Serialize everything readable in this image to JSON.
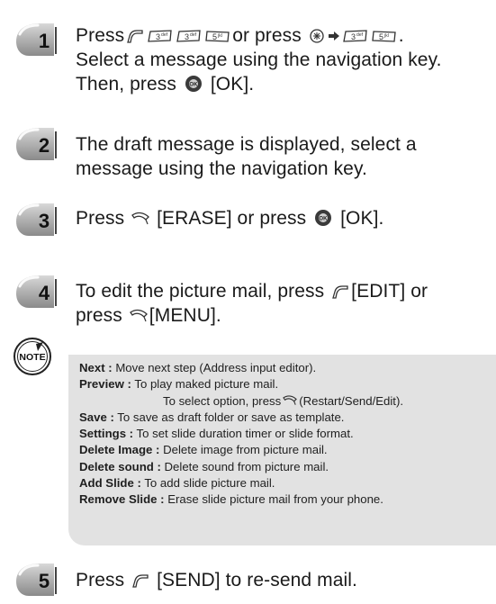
{
  "steps": [
    {
      "number": "1",
      "lines": [
        {
          "pre": "Press",
          "keys": [
            "send",
            "key-3",
            "key-3",
            "key-5"
          ],
          "post": "or press",
          "keys2": [
            "menu",
            "arrow",
            "key-3",
            "key-5"
          ],
          "post2": "."
        },
        {
          "text": "Select a message using the navigation key."
        },
        {
          "pre": "Then, press",
          "keys": [
            "ok"
          ],
          "post": "[OK]."
        }
      ]
    },
    {
      "number": "2",
      "lines": [
        {
          "text": "The draft message is displayed, select a"
        },
        {
          "text": "message using the navigation key."
        }
      ]
    },
    {
      "number": "3",
      "lines": [
        {
          "pre": "Press",
          "keys": [
            "soft-right"
          ],
          "post": "[ERASE] or press",
          "keys2": [
            "ok"
          ],
          "post2": "[OK]."
        }
      ]
    },
    {
      "number": "4",
      "lines": [
        {
          "pre": "To edit the picture mail, press",
          "keys": [
            "send"
          ],
          "post": "[EDIT] or"
        },
        {
          "pre": "press",
          "keys": [
            "soft-right"
          ],
          "post": "[MENU]."
        }
      ]
    },
    {
      "number": "5",
      "lines": [
        {
          "pre": "Press",
          "keys": [
            "send"
          ],
          "post": "[SEND] to re-send mail."
        }
      ]
    }
  ],
  "note": {
    "icon_label": "NOTE",
    "items": [
      {
        "term": "Next :",
        "desc": "Move next step (Address input editor)."
      },
      {
        "term": "Preview :",
        "desc": "To play maked picture mail."
      },
      {
        "term": "",
        "desc": "To select option, press",
        "key": "soft-right",
        "desc2": "(Restart/Send/Edit).",
        "indent": true
      },
      {
        "term": "Save :",
        "desc": "To save as draft folder or save as template."
      },
      {
        "term": "Settings :",
        "desc": "To set slide duration timer or slide format."
      },
      {
        "term": "Delete Image :",
        "desc": "Delete image from picture mail."
      },
      {
        "term": "Delete sound :",
        "desc": "Delete sound from picture mail."
      },
      {
        "term": "Add Slide :",
        "desc": "To add slide picture mail."
      },
      {
        "term": "Remove Slide :",
        "desc": "Erase slide picture mail from your phone."
      }
    ]
  }
}
